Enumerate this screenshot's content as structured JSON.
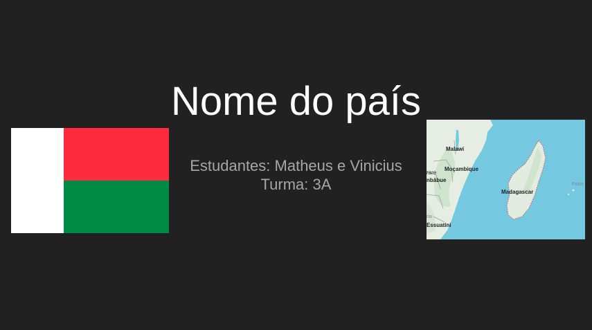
{
  "slide": {
    "title": "Nome do país",
    "students_line": "Estudantes: Matheus e Vinicius",
    "class_line": "Turma: 3A"
  },
  "flag": {
    "colors": {
      "white": "#ffffff",
      "red": "#fc2b3f",
      "green": "#008b44"
    }
  },
  "map": {
    "labels": {
      "malawi": "Malawi",
      "mozambique": "Moçambique",
      "madagascar": "Madagascar",
      "zimbabwe": "nbábue",
      "eswatini": "Essuatíni",
      "harare": "rare",
      "porto": "Porto",
      "pria": "ria"
    },
    "colors": {
      "sea": "#74c9e0",
      "land": "#e6eee4",
      "green": "#cfe4cc",
      "border": "#d45a5a"
    }
  },
  "theme": {
    "background": "#212121",
    "title_color": "#ffffff",
    "subtitle_color": "#a6a6a6"
  }
}
